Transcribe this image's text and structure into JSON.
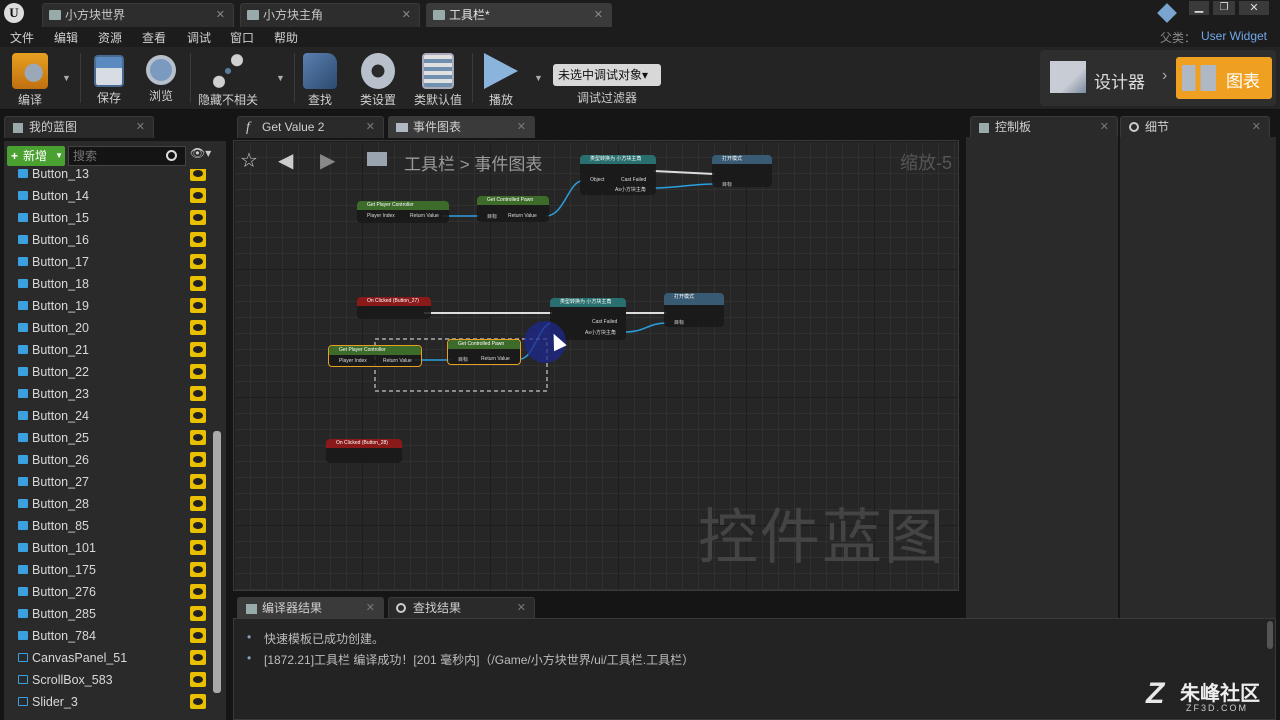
{
  "title_tabs": [
    {
      "label": "小方块世界"
    },
    {
      "label": "小方块主角"
    },
    {
      "label": "工具栏*"
    }
  ],
  "menu": [
    "文件",
    "编辑",
    "资源",
    "查看",
    "调试",
    "窗口",
    "帮助"
  ],
  "parent": {
    "label": "父类：",
    "value": "User Widget"
  },
  "toolbar": {
    "compile": "编译",
    "save": "保存",
    "browse": "浏览",
    "hide_unrelated": "隐藏不相关",
    "find": "查找",
    "class_settings": "类设置",
    "class_defaults": "类默认值",
    "play": "播放",
    "debug_select": "未选中调试对象▾",
    "debug_filter": "调试过滤器",
    "designer": "设计器",
    "graph": "图表"
  },
  "left_panel": {
    "tab": "我的蓝图",
    "add_new": "新增",
    "search_placeholder": "搜索",
    "items": [
      {
        "label": "Button_13",
        "icon": "button-icon"
      },
      {
        "label": "Button_14",
        "icon": "button-icon"
      },
      {
        "label": "Button_15",
        "icon": "button-icon"
      },
      {
        "label": "Button_16",
        "icon": "button-icon"
      },
      {
        "label": "Button_17",
        "icon": "button-icon"
      },
      {
        "label": "Button_18",
        "icon": "button-icon"
      },
      {
        "label": "Button_19",
        "icon": "button-icon"
      },
      {
        "label": "Button_20",
        "icon": "button-icon"
      },
      {
        "label": "Button_21",
        "icon": "button-icon"
      },
      {
        "label": "Button_22",
        "icon": "button-icon"
      },
      {
        "label": "Button_23",
        "icon": "button-icon"
      },
      {
        "label": "Button_24",
        "icon": "button-icon"
      },
      {
        "label": "Button_25",
        "icon": "button-icon"
      },
      {
        "label": "Button_26",
        "icon": "button-icon"
      },
      {
        "label": "Button_27",
        "icon": "button-icon"
      },
      {
        "label": "Button_28",
        "icon": "button-icon"
      },
      {
        "label": "Button_85",
        "icon": "button-icon"
      },
      {
        "label": "Button_101",
        "icon": "button-icon"
      },
      {
        "label": "Button_175",
        "icon": "button-icon"
      },
      {
        "label": "Button_276",
        "icon": "button-icon"
      },
      {
        "label": "Button_285",
        "icon": "button-icon"
      },
      {
        "label": "Button_784",
        "icon": "button-icon"
      },
      {
        "label": "CanvasPanel_51",
        "icon": "canvas-icon"
      },
      {
        "label": "ScrollBox_583",
        "icon": "scrollbox-icon"
      },
      {
        "label": "Slider_3",
        "icon": "slider-icon"
      }
    ]
  },
  "graph_tabs": [
    {
      "label": "Get Value 2"
    },
    {
      "label": "事件图表"
    }
  ],
  "graph": {
    "breadcrumb_root": "工具栏",
    "breadcrumb_sep": ">",
    "breadcrumb_leaf": "事件图表",
    "zoom": "缩放-5",
    "watermark": "控件蓝图",
    "nodes": {
      "get_pc": "Get Player Controller",
      "player_index": "Player Index",
      "return_value": "Return Value",
      "get_cp": "Get Controlled Pawn",
      "target": "目标",
      "on_clicked_27": "On Clicked (Button_27)",
      "on_clicked_28": "On Clicked (Button_28)",
      "cast": "类型转换为 小方块主角",
      "object": "Object",
      "cast_failed": "Cast Failed",
      "as": "As小方块主角",
      "fn": "打开模式",
      "fn_sub": "目标是小方块主角"
    }
  },
  "right_tabs": [
    {
      "label": "控制板"
    },
    {
      "label": "细节"
    }
  ],
  "bottom_tabs": [
    {
      "label": "编译器结果"
    },
    {
      "label": "查找结果"
    }
  ],
  "log": [
    "快速模板已成功创建。",
    "[1872.21]工具栏 编译成功！[201 毫秒内]（/Game/小方块世界/ui/工具栏.工具栏）"
  ],
  "logo": {
    "text": "朱峰社区",
    "sub": "ZF3D.COM"
  },
  "colors": {
    "accent": "#f0a020",
    "graph_bg": "#262626",
    "event_node": "#8a1a1a",
    "pure_node": "#3d6b2a",
    "cast_node": "#2a6f6f"
  }
}
